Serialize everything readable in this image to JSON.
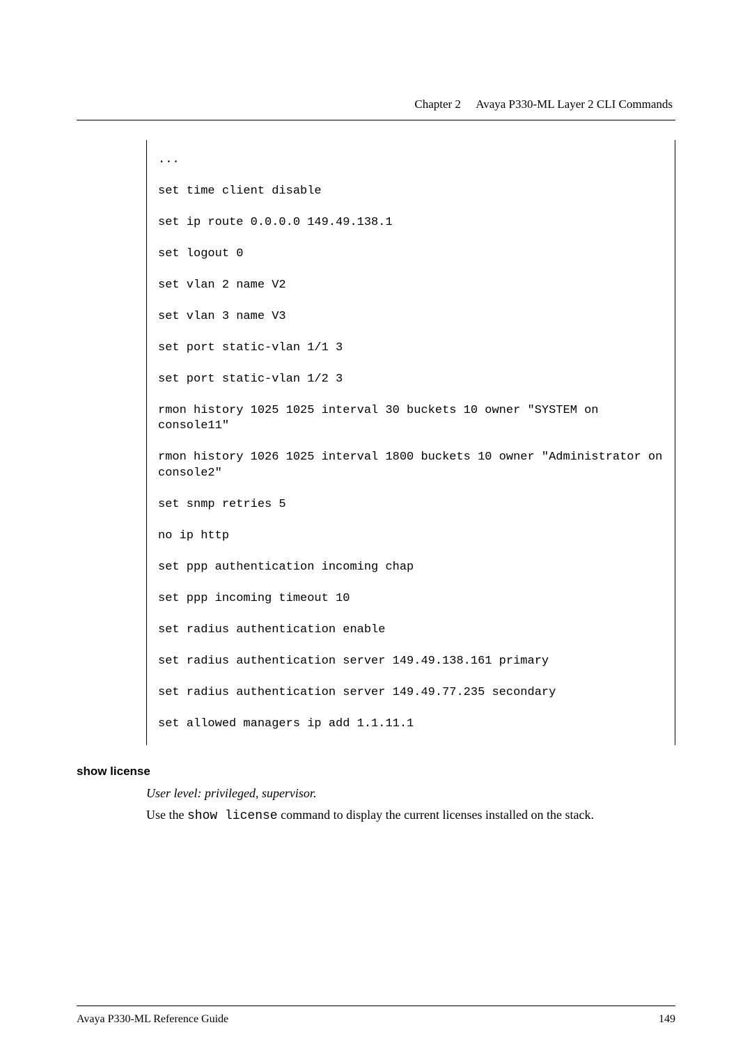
{
  "header": {
    "chapter": "Chapter 2",
    "title": "Avaya P330-ML Layer 2 CLI Commands"
  },
  "code": {
    "lines": [
      "...",
      "set time client disable",
      "set ip route 0.0.0.0 149.49.138.1",
      "set logout 0",
      "set vlan 2 name V2",
      "set vlan 3 name V3",
      "set port static-vlan 1/1 3",
      "set port static-vlan 1/2 3",
      "rmon history 1025 1025 interval 30 buckets 10 owner \"SYSTEM on console11\"",
      "rmon history 1026 1025 interval 1800 buckets 10 owner \"Administrator on console2\"",
      "set snmp retries 5",
      "no ip http",
      "set ppp authentication incoming chap",
      "set ppp incoming timeout 10",
      "set radius authentication enable",
      "set radius authentication server 149.49.138.161 primary",
      "set radius authentication server 149.49.77.235 secondary",
      "set allowed managers ip add 1.1.11.1"
    ]
  },
  "section": {
    "heading": "show license",
    "user_level": "User level: privileged, supervisor.",
    "desc_prefix": "Use the ",
    "desc_cmd": "show license",
    "desc_suffix": " command to display the current licenses installed on the stack."
  },
  "footer": {
    "left": "Avaya P330-ML Reference Guide",
    "right": "149"
  }
}
